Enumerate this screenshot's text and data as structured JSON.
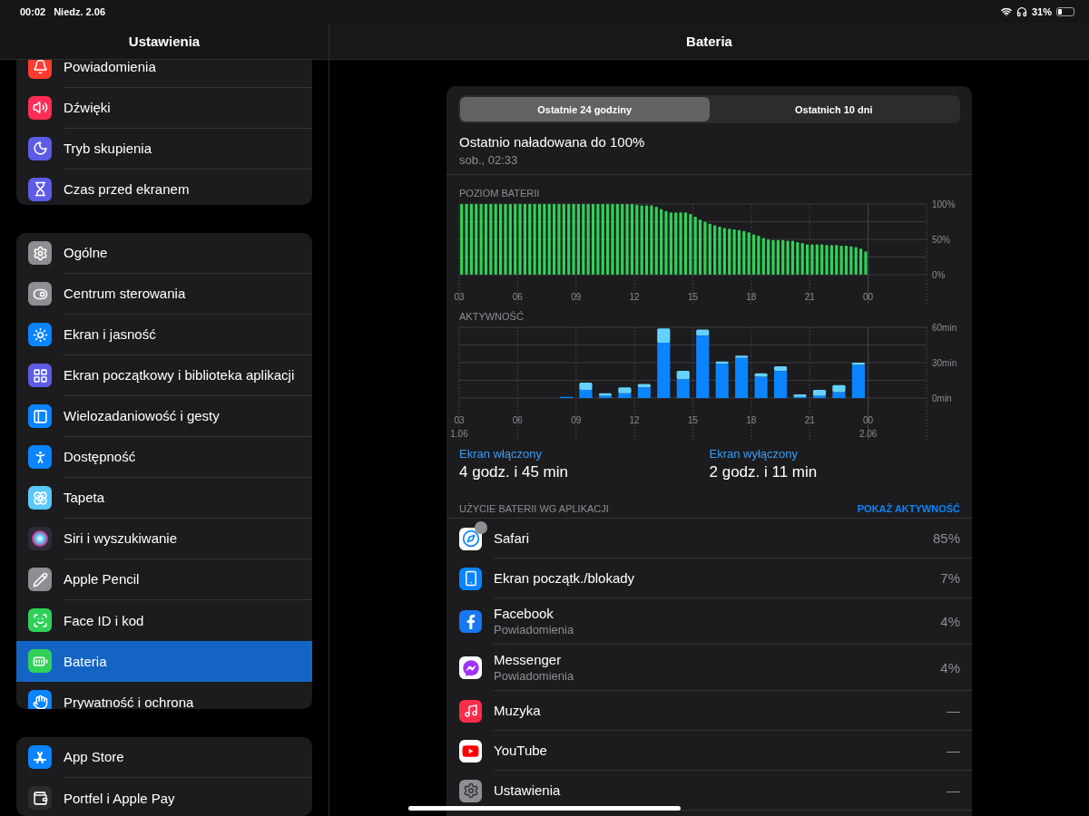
{
  "status_bar": {
    "time": "00:02",
    "date": "Niedz. 2.06",
    "battery": "31%"
  },
  "sidebar": {
    "title": "Ustawienia",
    "groups": [
      {
        "items": [
          {
            "label": "Powiadomienia",
            "color": "#ff3b30",
            "selected": false
          },
          {
            "label": "Dźwięki",
            "color": "#ff2d55",
            "selected": false
          },
          {
            "label": "Tryb skupienia",
            "color": "#5e5ce6",
            "selected": false
          },
          {
            "label": "Czas przed ekranem",
            "color": "#5e5ce6",
            "selected": false
          }
        ]
      },
      {
        "items": [
          {
            "label": "Ogólne",
            "color": "#8e8e93",
            "selected": false
          },
          {
            "label": "Centrum sterowania",
            "color": "#8e8e93",
            "selected": false
          },
          {
            "label": "Ekran i jasność",
            "color": "#0a84ff",
            "selected": false
          },
          {
            "label": "Ekran początkowy i biblioteka aplikacji",
            "color": "#5e5ce6",
            "selected": false
          },
          {
            "label": "Wielozadaniowość i gesty",
            "color": "#0a84ff",
            "selected": false
          },
          {
            "label": "Dostępność",
            "color": "#0a84ff",
            "selected": false
          },
          {
            "label": "Tapeta",
            "color": "#5ac8fa",
            "selected": false
          },
          {
            "label": "Siri i wyszukiwanie",
            "color": "#2c2c3a",
            "selected": false
          },
          {
            "label": "Apple Pencil",
            "color": "#8e8e93",
            "selected": false
          },
          {
            "label": "Face ID i kod",
            "color": "#30d158",
            "selected": false
          },
          {
            "label": "Bateria",
            "color": "#30d158",
            "selected": true
          },
          {
            "label": "Prywatność i ochrona",
            "color": "#0a84ff",
            "selected": false
          }
        ]
      },
      {
        "items": [
          {
            "label": "App Store",
            "color": "#0a84ff",
            "selected": false
          },
          {
            "label": "Portfel i Apple Pay",
            "color": "#2c2c2e",
            "selected": false
          }
        ]
      }
    ]
  },
  "detail": {
    "title": "Bateria",
    "segments": [
      {
        "label": "Ostatnie 24 godziny",
        "selected": true
      },
      {
        "label": "Ostatnich 10 dni",
        "selected": false
      }
    ],
    "last_charged": {
      "title": "Ostatnio naładowana do 100%",
      "time": "sob., 02:33"
    },
    "battery_level": {
      "title": "POZIOM BATERII",
      "chart_data": {
        "type": "bar",
        "xlim": [
          3,
          27
        ],
        "ylim": [
          0,
          100
        ],
        "x": [
          3.125,
          3.375,
          3.625,
          3.875,
          4.125,
          4.375,
          4.625,
          4.875,
          5.125,
          5.375,
          5.625,
          5.875,
          6.125,
          6.375,
          6.625,
          6.875,
          7.125,
          7.375,
          7.625,
          7.875,
          8.125,
          8.375,
          8.625,
          8.875,
          9.125,
          9.375,
          9.625,
          9.875,
          10.125,
          10.375,
          10.625,
          10.875,
          11.125,
          11.375,
          11.625,
          11.875,
          12.125,
          12.375,
          12.625,
          12.875,
          13.125,
          13.375,
          13.625,
          13.875,
          14.125,
          14.375,
          14.625,
          14.875,
          15.125,
          15.375,
          15.625,
          15.875,
          16.125,
          16.375,
          16.625,
          16.875,
          17.125,
          17.375,
          17.625,
          17.875,
          18.125,
          18.375,
          18.625,
          18.875,
          19.125,
          19.375,
          19.625,
          19.875,
          20.125,
          20.375,
          20.625,
          20.875,
          21.125,
          21.375,
          21.625,
          21.875,
          22.125,
          22.375,
          22.625,
          22.875,
          23.125,
          23.375,
          23.625,
          23.875
        ],
        "values": [
          100,
          100,
          100,
          100,
          100,
          100,
          100,
          100,
          100,
          100,
          100,
          100,
          100,
          100,
          100,
          100,
          100,
          100,
          100,
          100,
          100,
          100,
          100,
          100,
          100,
          100,
          100,
          100,
          100,
          100,
          100,
          100,
          100,
          100,
          100,
          100,
          99,
          98,
          98,
          98,
          96,
          93,
          90,
          88,
          88,
          88,
          88,
          86,
          82,
          78,
          75,
          72,
          70,
          68,
          66,
          65,
          64,
          63,
          62,
          60,
          57,
          55,
          52,
          50,
          49,
          49,
          49,
          48,
          48,
          46,
          45,
          43,
          43,
          43,
          43,
          42,
          42,
          42,
          41,
          41,
          40,
          39,
          37,
          33
        ],
        "xticks": [
          {
            "value": 3,
            "label": "03"
          },
          {
            "value": 6,
            "label": "06"
          },
          {
            "value": 9,
            "label": "09"
          },
          {
            "value": 12,
            "label": "12"
          },
          {
            "value": 15,
            "label": "15"
          },
          {
            "value": 18,
            "label": "18"
          },
          {
            "value": 21,
            "label": "21"
          }
        ],
        "yticks": [
          {
            "value": 0,
            "label": "0%"
          },
          {
            "value": 50,
            "label": "50%"
          },
          {
            "value": 100,
            "label": "100%"
          }
        ],
        "grid": true,
        "ref_lines": [
          {
            "axis": "x",
            "value": 24
          }
        ]
      },
      "midnight_label": "00"
    },
    "activity": {
      "title": "AKTYWNOŚĆ",
      "chart_data": {
        "type": "bar",
        "stacked": true,
        "xlim": [
          3,
          27
        ],
        "ylim": [
          0,
          60
        ],
        "x": [
          3.5,
          4.5,
          5.5,
          6.5,
          7.5,
          8.5,
          9.5,
          10.5,
          11.5,
          12.5,
          13.5,
          14.5,
          15.5,
          16.5,
          17.5,
          18.5,
          19.5,
          20.5,
          21.5,
          22.5,
          23.5
        ],
        "series": [
          {
            "name": "Ekran włączony",
            "color": "#0a84ff",
            "values": [
              0,
              0,
              0,
              0,
              0,
              1,
              7,
              2,
              4,
              9,
              47,
              16,
              53,
              29,
              34,
              18,
              23,
              1,
              2,
              5,
              28
            ]
          },
          {
            "name": "Ekran wyłączony",
            "color": "#64d2ff",
            "values": [
              0,
              0,
              0,
              0,
              0,
              0,
              6,
              2,
              5,
              3,
              12,
              7,
              5,
              2,
              2,
              3,
              4,
              2,
              5,
              6,
              2
            ]
          }
        ],
        "xticks": [
          {
            "value": 3,
            "label": "03"
          },
          {
            "value": 6,
            "label": "06"
          },
          {
            "value": 9,
            "label": "09"
          },
          {
            "value": 12,
            "label": "12"
          },
          {
            "value": 15,
            "label": "15"
          },
          {
            "value": 18,
            "label": "18"
          },
          {
            "value": 21,
            "label": "21"
          }
        ],
        "yticks": [
          {
            "value": 0,
            "label": "0min"
          },
          {
            "value": 30,
            "label": "30min"
          },
          {
            "value": 60,
            "label": "60min"
          }
        ],
        "grid": true,
        "ref_lines": [
          {
            "axis": "x",
            "value": 24
          }
        ],
        "annotations": [
          "1.06",
          "2.06"
        ]
      },
      "midnight_label": "00"
    },
    "screen_time": [
      {
        "value": "4 godz. i 45 min"
      },
      {
        "value": "2 godz. i 11 min"
      }
    ],
    "usage": {
      "title": "UŻYCIE BATERII WG APLIKACJI",
      "action": "POKAŻ AKTYWNOŚĆ",
      "apps": [
        {
          "name": "Safari",
          "percent": "85%"
        },
        {
          "name": "Ekran początk./blokady",
          "percent": "7%"
        },
        {
          "name": "Facebook",
          "subtitle": "Powiadomienia",
          "percent": "4%"
        },
        {
          "name": "Messenger",
          "subtitle": "Powiadomienia",
          "percent": "4%"
        },
        {
          "name": "Muzyka",
          "percent": "—"
        },
        {
          "name": "YouTube",
          "percent": "—"
        },
        {
          "name": "Ustawienia",
          "percent": "—"
        }
      ]
    }
  }
}
